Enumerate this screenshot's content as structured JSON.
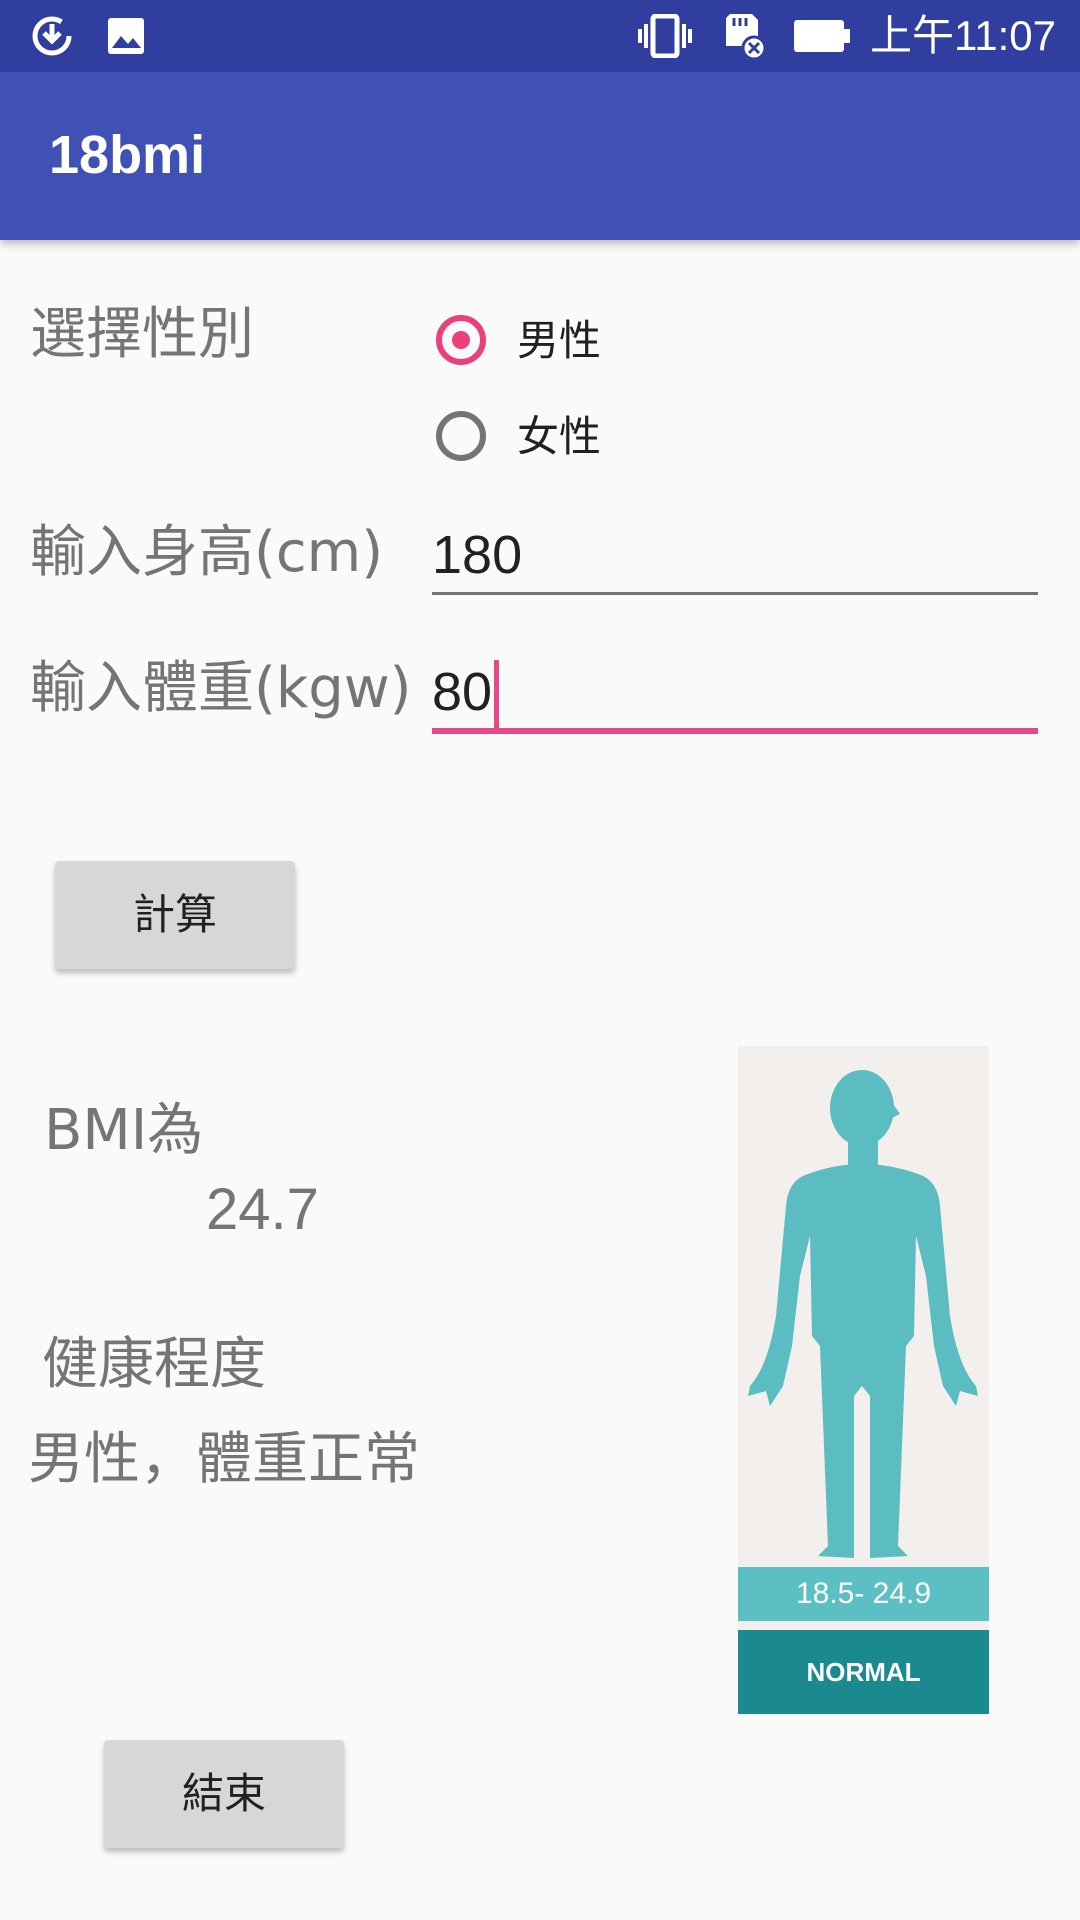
{
  "status_bar": {
    "time": "上午11:07",
    "icons": [
      "download-icon",
      "image-icon",
      "vibrate-icon",
      "sd-card-error-icon",
      "battery-icon"
    ]
  },
  "app_bar": {
    "title": "18bmi"
  },
  "form": {
    "gender_label": "選擇性別",
    "gender_options": [
      {
        "label": "男性",
        "selected": true
      },
      {
        "label": "女性",
        "selected": false
      }
    ],
    "height_label": "輸入身高(cm)",
    "height_value": "180",
    "weight_label": "輸入體重(kgw)",
    "weight_value": "80"
  },
  "buttons": {
    "calculate": "計算",
    "exit": "結束"
  },
  "result": {
    "bmi_label": "BMI為",
    "bmi_value": "24.7",
    "health_label": "健康程度",
    "health_value": "男性，體重正常"
  },
  "figure": {
    "range": "18.5- 24.9",
    "status": "NORMAL",
    "colors": {
      "body": "#5bbcc2",
      "range_band": "#5cbfc3",
      "status_band": "#1b8a8f",
      "background": "#f2efec"
    }
  },
  "colors": {
    "primary": "#3f51b5",
    "primary_dark": "#303f9f",
    "accent": "#ec407a"
  }
}
